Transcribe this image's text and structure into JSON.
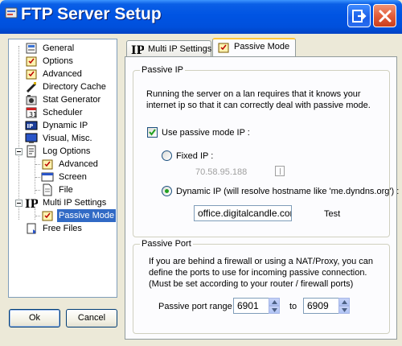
{
  "window": {
    "title": "FTP Server Setup"
  },
  "tree": {
    "items": [
      {
        "label": "General",
        "icon": "general-icon"
      },
      {
        "label": "Options",
        "icon": "options-icon"
      },
      {
        "label": "Advanced",
        "icon": "advanced-icon"
      },
      {
        "label": "Directory Cache",
        "icon": "directory-cache-icon"
      },
      {
        "label": "Stat Generator",
        "icon": "stat-generator-icon"
      },
      {
        "label": "Scheduler",
        "icon": "scheduler-icon"
      },
      {
        "label": "Dynamic IP",
        "icon": "dynamic-ip-icon"
      },
      {
        "label": "Visual, Misc.",
        "icon": "visual-misc-icon"
      },
      {
        "label": "Log Options",
        "icon": "log-options-icon"
      },
      {
        "label": "Advanced",
        "icon": "log-advanced-icon"
      },
      {
        "label": "Screen",
        "icon": "screen-icon"
      },
      {
        "label": "File",
        "icon": "file-icon"
      },
      {
        "label": "Multi IP Settings",
        "icon": "multi-ip-icon"
      },
      {
        "label": "Passive Mode",
        "icon": "passive-mode-icon",
        "selected": true
      },
      {
        "label": "Free Files",
        "icon": "free-files-icon"
      }
    ]
  },
  "buttons": {
    "ok": "Ok",
    "cancel": "Cancel"
  },
  "tabs": [
    {
      "label": "Multi IP Settings",
      "active": false
    },
    {
      "label": "Passive Mode",
      "active": true
    }
  ],
  "passive_ip": {
    "group_title": "Passive IP",
    "description_line1": "Running the server on a lan requires that it knows your",
    "description_line2": "internet ip so that it can correctly deal with passive mode.",
    "use_passive_label": "Use passive mode IP :",
    "use_passive_checked": true,
    "fixed_ip_label": "Fixed IP :",
    "fixed_ip_value": "70.58.95.188",
    "dynamic_ip_label": "Dynamic IP (will resolve hostname like 'me.dyndns.org') :",
    "selected_mode": "dynamic",
    "hostname_value": "office.digitalcandle.com",
    "test_label": "Test"
  },
  "passive_port": {
    "group_title": "Passive Port",
    "description_line1": "If you are behind a firewall or using a NAT/Proxy, you can",
    "description_line2": "define the ports to use for incoming passive connection.",
    "description_line3": "(Must be set according to your router / firewall ports)",
    "range_label": "Passive port range",
    "from_value": "6901",
    "to_label": "to",
    "to_value": "6909"
  },
  "colors": {
    "titlebar": "#0054e3",
    "selection": "#316ac5",
    "tab_highlight": "#ffc73c"
  }
}
